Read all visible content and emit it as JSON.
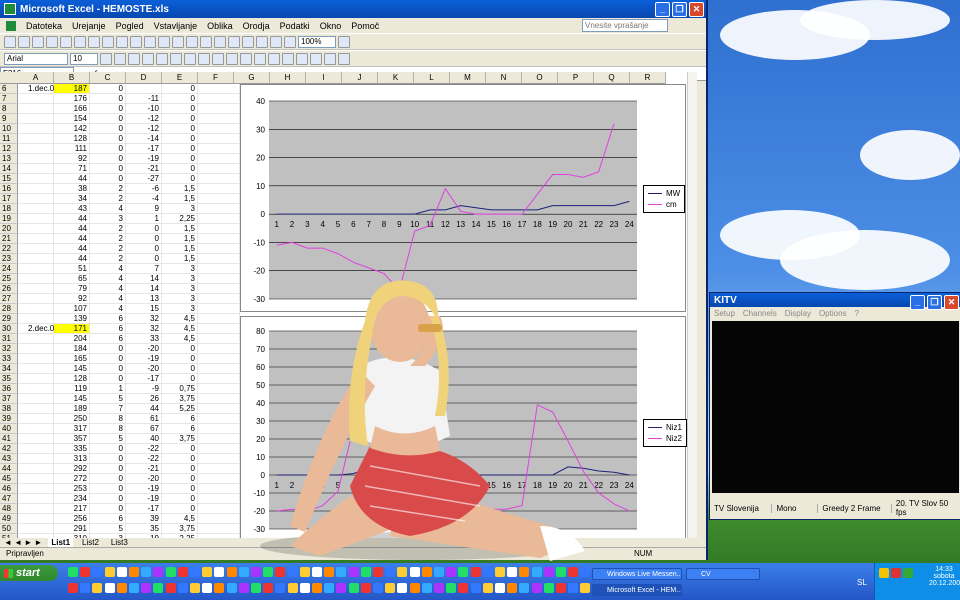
{
  "excel": {
    "title": "Microsoft Excel - HEMOSTE.xls",
    "menu": [
      "Datoteka",
      "Urejanje",
      "Pogled",
      "Vstavljanje",
      "Oblika",
      "Orodja",
      "Podatki",
      "Okno",
      "Pomoč"
    ],
    "help_placeholder": "Vnesite vprašanje",
    "font_name": "Arial",
    "font_size": "10",
    "zoom": "100%",
    "cell_ref": "F316",
    "fx": "fx",
    "columns": [
      "A",
      "B",
      "C",
      "D",
      "E",
      "F",
      "G",
      "H",
      "I",
      "J",
      "K",
      "L",
      "M",
      "N",
      "O",
      "P",
      "Q",
      "R"
    ],
    "rows": [
      {
        "n": "6",
        "a": "1.dec.08",
        "b": "187",
        "c": "0",
        "d": "",
        "e": "0",
        "hl": true
      },
      {
        "n": "7",
        "a": "",
        "b": "176",
        "c": "0",
        "d": "-11",
        "e": "0"
      },
      {
        "n": "8",
        "a": "",
        "b": "166",
        "c": "0",
        "d": "-10",
        "e": "0"
      },
      {
        "n": "9",
        "a": "",
        "b": "154",
        "c": "0",
        "d": "-12",
        "e": "0"
      },
      {
        "n": "10",
        "a": "",
        "b": "142",
        "c": "0",
        "d": "-12",
        "e": "0"
      },
      {
        "n": "11",
        "a": "",
        "b": "128",
        "c": "0",
        "d": "-14",
        "e": "0"
      },
      {
        "n": "12",
        "a": "",
        "b": "111",
        "c": "0",
        "d": "-17",
        "e": "0"
      },
      {
        "n": "13",
        "a": "",
        "b": "92",
        "c": "0",
        "d": "-19",
        "e": "0"
      },
      {
        "n": "14",
        "a": "",
        "b": "71",
        "c": "0",
        "d": "-21",
        "e": "0"
      },
      {
        "n": "15",
        "a": "",
        "b": "44",
        "c": "0",
        "d": "-27",
        "e": "0"
      },
      {
        "n": "16",
        "a": "",
        "b": "38",
        "c": "2",
        "d": "-6",
        "e": "1,5"
      },
      {
        "n": "17",
        "a": "",
        "b": "34",
        "c": "2",
        "d": "-4",
        "e": "1,5"
      },
      {
        "n": "18",
        "a": "",
        "b": "43",
        "c": "4",
        "d": "9",
        "e": "3"
      },
      {
        "n": "19",
        "a": "",
        "b": "44",
        "c": "3",
        "d": "1",
        "e": "2,25"
      },
      {
        "n": "20",
        "a": "",
        "b": "44",
        "c": "2",
        "d": "0",
        "e": "1,5"
      },
      {
        "n": "21",
        "a": "",
        "b": "44",
        "c": "2",
        "d": "0",
        "e": "1,5"
      },
      {
        "n": "22",
        "a": "",
        "b": "44",
        "c": "2",
        "d": "0",
        "e": "1,5"
      },
      {
        "n": "23",
        "a": "",
        "b": "44",
        "c": "2",
        "d": "0",
        "e": "1,5"
      },
      {
        "n": "24",
        "a": "",
        "b": "51",
        "c": "4",
        "d": "7",
        "e": "3"
      },
      {
        "n": "25",
        "a": "",
        "b": "65",
        "c": "4",
        "d": "14",
        "e": "3"
      },
      {
        "n": "26",
        "a": "",
        "b": "79",
        "c": "4",
        "d": "14",
        "e": "3"
      },
      {
        "n": "27",
        "a": "",
        "b": "92",
        "c": "4",
        "d": "13",
        "e": "3"
      },
      {
        "n": "28",
        "a": "",
        "b": "107",
        "c": "4",
        "d": "15",
        "e": "3"
      },
      {
        "n": "29",
        "a": "",
        "b": "139",
        "c": "6",
        "d": "32",
        "e": "4,5"
      },
      {
        "n": "30",
        "a": "2.dec.08",
        "b": "171",
        "c": "6",
        "d": "32",
        "e": "4,5",
        "hl": true
      },
      {
        "n": "31",
        "a": "",
        "b": "204",
        "c": "6",
        "d": "33",
        "e": "4,5"
      },
      {
        "n": "32",
        "a": "",
        "b": "184",
        "c": "0",
        "d": "-20",
        "e": "0"
      },
      {
        "n": "33",
        "a": "",
        "b": "165",
        "c": "0",
        "d": "-19",
        "e": "0"
      },
      {
        "n": "34",
        "a": "",
        "b": "145",
        "c": "0",
        "d": "-20",
        "e": "0"
      },
      {
        "n": "35",
        "a": "",
        "b": "128",
        "c": "0",
        "d": "-17",
        "e": "0"
      },
      {
        "n": "36",
        "a": "",
        "b": "119",
        "c": "1",
        "d": "-9",
        "e": "0,75"
      },
      {
        "n": "37",
        "a": "",
        "b": "145",
        "c": "5",
        "d": "26",
        "e": "3,75"
      },
      {
        "n": "38",
        "a": "",
        "b": "189",
        "c": "7",
        "d": "44",
        "e": "5,25"
      },
      {
        "n": "39",
        "a": "",
        "b": "250",
        "c": "8",
        "d": "61",
        "e": "6"
      },
      {
        "n": "40",
        "a": "",
        "b": "317",
        "c": "8",
        "d": "67",
        "e": "6"
      },
      {
        "n": "41",
        "a": "",
        "b": "357",
        "c": "5",
        "d": "40",
        "e": "3,75"
      },
      {
        "n": "42",
        "a": "",
        "b": "335",
        "c": "0",
        "d": "-22",
        "e": "0"
      },
      {
        "n": "43",
        "a": "",
        "b": "313",
        "c": "0",
        "d": "-22",
        "e": "0"
      },
      {
        "n": "44",
        "a": "",
        "b": "292",
        "c": "0",
        "d": "-21",
        "e": "0"
      },
      {
        "n": "45",
        "a": "",
        "b": "272",
        "c": "0",
        "d": "-20",
        "e": "0"
      },
      {
        "n": "46",
        "a": "",
        "b": "253",
        "c": "0",
        "d": "-19",
        "e": "0"
      },
      {
        "n": "47",
        "a": "",
        "b": "234",
        "c": "0",
        "d": "-19",
        "e": "0"
      },
      {
        "n": "48",
        "a": "",
        "b": "217",
        "c": "0",
        "d": "-17",
        "e": "0"
      },
      {
        "n": "49",
        "a": "",
        "b": "256",
        "c": "6",
        "d": "39",
        "e": "4,5"
      },
      {
        "n": "50",
        "a": "",
        "b": "291",
        "c": "5",
        "d": "35",
        "e": "3,75"
      },
      {
        "n": "51",
        "a": "",
        "b": "310",
        "c": "3",
        "d": "19",
        "e": "2,25"
      },
      {
        "n": "52",
        "a": "",
        "b": "312",
        "c": "2",
        "d": "2",
        "e": "1,5"
      }
    ],
    "sheet_tabs": [
      "List1",
      "List2",
      "List3"
    ],
    "status_left": "Pripravljen",
    "status_num": "NUM"
  },
  "chart_data": [
    {
      "type": "line",
      "x": [
        1,
        2,
        3,
        4,
        5,
        6,
        7,
        8,
        9,
        10,
        11,
        12,
        13,
        14,
        15,
        16,
        17,
        18,
        19,
        20,
        21,
        22,
        23,
        24
      ],
      "ylim": [
        -30,
        40
      ],
      "yticks": [
        -30,
        -20,
        -10,
        0,
        10,
        20,
        30,
        40
      ],
      "series": [
        {
          "name": "MW",
          "color": "#1f1f7a",
          "values": [
            0,
            0,
            0,
            0,
            0,
            0,
            0,
            0,
            0,
            0,
            1.5,
            1.5,
            3,
            2.25,
            1.5,
            1.5,
            1.5,
            1.5,
            3,
            3,
            3,
            3,
            3,
            4.5
          ]
        },
        {
          "name": "cm",
          "color": "#e040e0",
          "values": [
            -11,
            -10,
            -12,
            -12,
            -14,
            -17,
            -19,
            -21,
            -27,
            -6,
            -4,
            9,
            1,
            0,
            0,
            0,
            0,
            7,
            14,
            14,
            13,
            15,
            32
          ]
        }
      ],
      "legend": "right"
    },
    {
      "type": "line",
      "x": [
        1,
        2,
        3,
        4,
        5,
        6,
        7,
        8,
        9,
        10,
        11,
        12,
        13,
        14,
        15,
        16,
        17,
        18,
        19,
        20,
        21,
        22,
        23,
        24
      ],
      "ylim": [
        -30,
        80
      ],
      "yticks": [
        -30,
        -20,
        -10,
        0,
        10,
        20,
        30,
        40,
        50,
        60,
        70,
        80
      ],
      "series": [
        {
          "name": "Niz1",
          "color": "#1f1f7a",
          "values": [
            0,
            0,
            0,
            0,
            0,
            0.75,
            3.75,
            5.25,
            6,
            6,
            3.75,
            0,
            0,
            0,
            0,
            0,
            0,
            0,
            0,
            4.5,
            3.75,
            2.25,
            1.5,
            0
          ]
        },
        {
          "name": "Niz2",
          "color": "#e040e0",
          "values": [
            -20,
            -19,
            -20,
            -17,
            -9,
            26,
            44,
            61,
            67,
            40,
            -22,
            -22,
            -21,
            -20,
            -19,
            -19,
            -17,
            39,
            35,
            19,
            2,
            -10,
            -16,
            -20
          ]
        }
      ],
      "legend": "right"
    }
  ],
  "tv": {
    "title": "KITV",
    "menu": [
      "Setup",
      "Channels",
      "Display",
      "Options",
      "?"
    ],
    "status": [
      "TV Slovenija",
      "Mono",
      "Greedy 2 Frame",
      "20. TV Slov  50 fps"
    ]
  },
  "taskbar": {
    "start": "start",
    "tasks": [
      "Windows Live Messen...",
      "CV",
      "Microsoft Excel - HEM..."
    ],
    "lang": "SL",
    "time": "14:33",
    "day": "sobota",
    "date": "20.12.2008"
  }
}
